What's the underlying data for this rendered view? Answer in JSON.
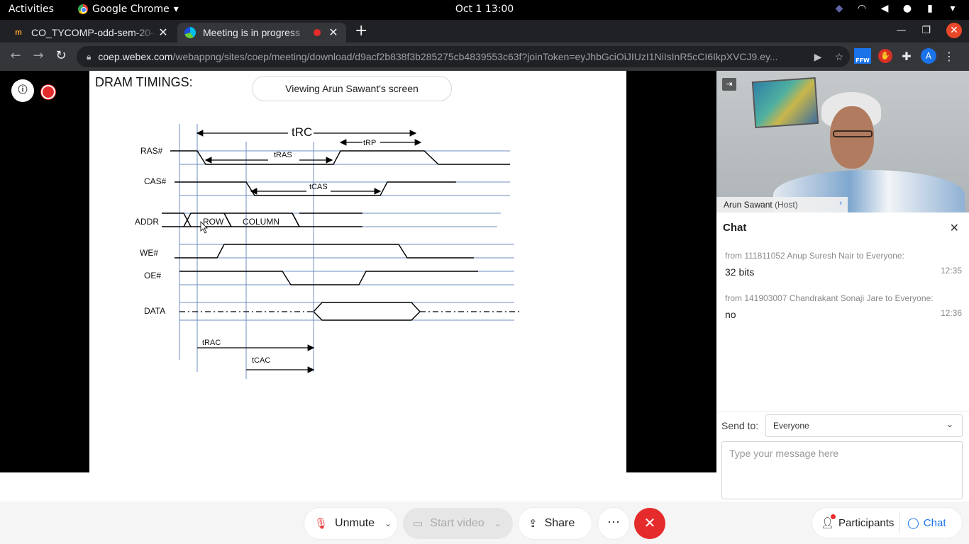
{
  "os": {
    "activities": "Activities",
    "app_name": "Google Chrome",
    "clock": "Oct 1  13:00"
  },
  "tabs": [
    {
      "title": "CO_TYCOMP-odd-sem-20-",
      "favicon": "moodle-icon"
    },
    {
      "title": "Meeting is in progress",
      "favicon": "webex-icon",
      "recording": true
    }
  ],
  "address": {
    "host": "coep.webex.com",
    "path": "/webappng/sites/coep/meeting/download/d9acf2b838f3b285275cb4839553c63f?joinToken=eyJhbGciOiJIUzI1NiIsInR5cCI6IkpXVCJ9.ey..."
  },
  "extensions": {
    "ffw_label": "FFW",
    "profile_initial": "A"
  },
  "slide": {
    "title": "DRAM TIMINGS:",
    "viewing": "Viewing Arun Sawant's screen",
    "signals": [
      "RAS#",
      "CAS#",
      "ADDR",
      "WE#",
      "OE#",
      "DATA"
    ],
    "addr_row": "ROW",
    "addr_col": "COLUMN",
    "labels": {
      "trc": "tRC",
      "trp": "tRP",
      "tras": "tRAS",
      "tcas": "tCAS",
      "trac": "tRAC",
      "tcac": "tCAC"
    }
  },
  "video": {
    "name": "Arun Sawant",
    "role": "(Host)"
  },
  "chat": {
    "title": "Chat",
    "messages": [
      {
        "from": "from 111811052 Anup Suresh Nair to Everyone:",
        "text": "32 bits",
        "time": "12:35"
      },
      {
        "from": "from 141903007 Chandrakant Sonaji Jare to Everyone:",
        "text": "no",
        "time": "12:36"
      }
    ],
    "send_to_label": "Send to:",
    "send_to_value": "Everyone",
    "placeholder": "Type your message here"
  },
  "controls": {
    "unmute": "Unmute",
    "start_video": "Start video",
    "share": "Share",
    "participants": "Participants",
    "chat": "Chat"
  },
  "colors": {
    "accent": "#1a73e8",
    "danger": "#e52b2b"
  }
}
